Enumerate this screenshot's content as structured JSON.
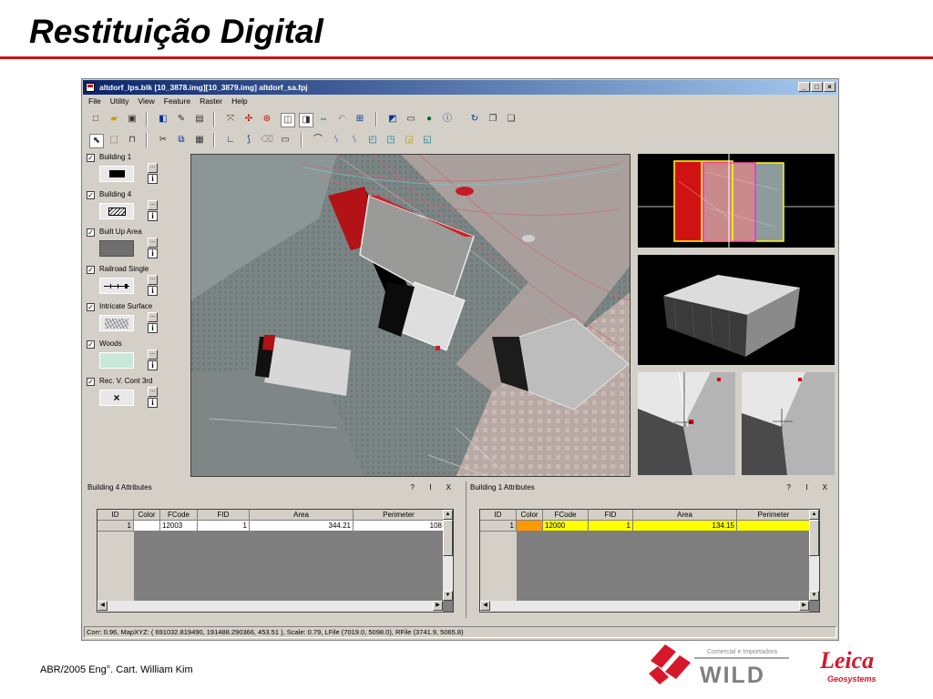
{
  "slide": {
    "title": "Restituição Digital",
    "footer": "ABR/2005 Eng°. Cart. William Kim"
  },
  "window": {
    "title": "altdorf_lps.blk [10_3878.img][10_3879.img]  altdorf_sa.fpj",
    "controls": [
      "_",
      "□",
      "×"
    ]
  },
  "menu": [
    "File",
    "Utility",
    "View",
    "Feature",
    "Raster",
    "Help"
  ],
  "features": [
    {
      "label": "Building 1",
      "swatch": "black-rect",
      "checked": "✓"
    },
    {
      "label": "Building 4",
      "swatch": "hatched-rect",
      "checked": "✓"
    },
    {
      "label": "Built Up Area",
      "swatch": "gray-fill",
      "checked": "✓"
    },
    {
      "label": "Railroad Single",
      "swatch": "railroad-line",
      "checked": "✓"
    },
    {
      "label": "Intricate Surface",
      "swatch": "intricate-texture",
      "checked": "✓"
    },
    {
      "label": "Woods",
      "swatch": "light-green-fill",
      "checked": "✓"
    },
    {
      "label": "Rec. V. Cont 3rd",
      "swatch": "x-mark",
      "checked": "✓"
    }
  ],
  "feature_buttons": {
    "more": "...",
    "info": "i"
  },
  "panes": {
    "left": {
      "title": "Building 4 Attributes",
      "controls": "? I X",
      "columns": [
        "ID",
        "Color",
        "FCode",
        "FID",
        "Area",
        "Perimeter"
      ],
      "row": {
        "id": "1",
        "color": "#ffffff",
        "fcode": "12003",
        "fid": "1",
        "area": "344.21",
        "perimeter": "108"
      }
    },
    "right": {
      "title": "Building 1 Attributes",
      "controls": "? I X",
      "columns": [
        "ID",
        "Color",
        "FCode",
        "FID",
        "Area",
        "Perimeter"
      ],
      "row": {
        "id": "1",
        "color": "#ff9900",
        "fcode": "12000",
        "fid": "1",
        "area": "134.15",
        "perimeter": ""
      }
    }
  },
  "status": "Corr: 0.96, MapXYZ: ( 691032.819490, 191488.290366, 453.51 ), Scale: 0.79, LFile (7019.0, 5098.0), RFile (3741.9, 5065.8)",
  "logos": {
    "wild_tagline": "Comercial e Importadora",
    "wild_name": "WILD",
    "leica_name": "Leica",
    "leica_sub": "Geosystems"
  },
  "colors": {
    "accent_red": "#c4161c",
    "titlebar_start": "#0a246a",
    "selected_row": "#ffff00"
  }
}
